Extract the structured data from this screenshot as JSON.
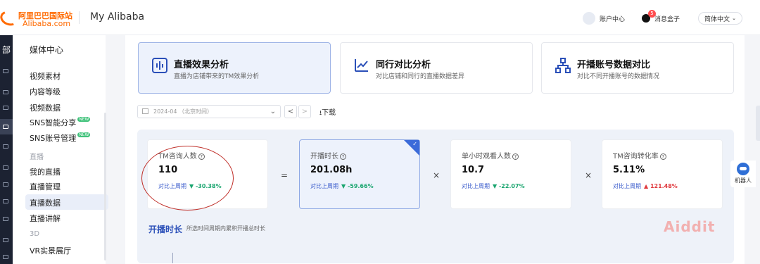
{
  "header": {
    "logo_cn": "阿里巴巴国际站",
    "logo_en": "Alibaba.com",
    "app_title": "My Alibaba",
    "account": "账户中心",
    "message_badge": "5",
    "message": "消息盒子",
    "language": "简体中文"
  },
  "rail": {
    "top_label": "部"
  },
  "sidebar": {
    "section_title": "媒体中心",
    "items": [
      "视频素材",
      "内容等级",
      "视频数据",
      "SNS智能分享",
      "SNS账号管理"
    ],
    "new_tag": "NEW",
    "group_live": "直播",
    "live_items": [
      "我的直播",
      "直播管理",
      "直播数据",
      "直播讲解"
    ],
    "group_3d": "3D",
    "items_3d": [
      "VR实景展厅"
    ]
  },
  "tabs": [
    {
      "title": "直播效果分析",
      "subtitle": "直播为店铺带来的TM效果分析"
    },
    {
      "title": "同行对比分析",
      "subtitle": "对比店铺和同行的直播数据差异"
    },
    {
      "title": "开播账号数据对比",
      "subtitle": "对比不同开播账号的数据情况"
    }
  ],
  "toolbar": {
    "date_value": "2024-04 （北京时间）",
    "prev": "<",
    "next": ">",
    "download": "下载"
  },
  "metrics": [
    {
      "label": "TM咨询人数",
      "value": "110",
      "compare_label": "对比上周期",
      "change": "-30.38%",
      "direction": "down"
    },
    {
      "label": "开播时长",
      "value": "201.08h",
      "compare_label": "对比上周期",
      "change": "-59.66%",
      "direction": "down"
    },
    {
      "label": "单小时观看人数",
      "value": "10.7",
      "compare_label": "对比上周期",
      "change": "-22.07%",
      "direction": "down"
    },
    {
      "label": "TM咨询转化率",
      "value": "5.11%",
      "compare_label": "对比上周期",
      "change": "121.48%",
      "direction": "up"
    }
  ],
  "operators": [
    "=",
    "×",
    "×"
  ],
  "section": {
    "title": "开播时长",
    "subtitle": "所选时间周期内累积开播总时长"
  },
  "watermark": "Aiddit",
  "robot": {
    "label": "机器人"
  },
  "colors": {
    "accent": "#3b6bd9",
    "down": "#1aa56f",
    "up": "#e0393e",
    "brand": "#ff6a00"
  }
}
